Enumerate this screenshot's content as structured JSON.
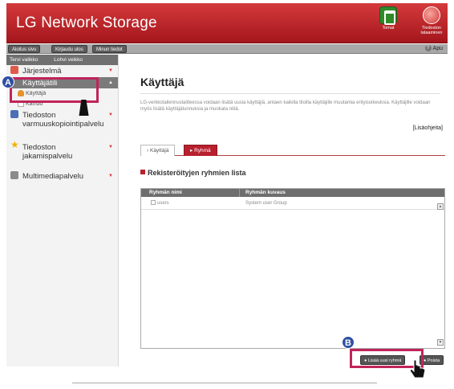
{
  "header": {
    "title": "LG Network Storage",
    "users_label": "Tomat",
    "help_label": "Tiedoston lataaminen"
  },
  "toolbar": {
    "btn1": "Aloitus sivu",
    "btn2": "Kirjaudu ulos",
    "btn3": "Minun tiedot",
    "help": "Apu"
  },
  "sidebar": {
    "top": [
      "Tervi valikko",
      "Lohvi veikko"
    ],
    "system": "Järjestelmä",
    "account": "Käyttäjätili",
    "user": "Käyttäjä",
    "group": "Kansio",
    "backup_line1": "Tiedoston",
    "backup_line2": "varmuuskopiointipalvelu",
    "share_line1": "Tiedoston",
    "share_line2": "jakamispalvelu",
    "media": "Multimediapalvelu"
  },
  "main": {
    "title": "Käyttäjä",
    "description": "LG-verkkotallennuslaitteessa voidaan lisätä uusia käyttäjiä, antaen kaikilla tiloilla käyttäjille muutamia erityisoikeuksia. Käyttäjille voidaan myös lisätä käyttäjätunnuksia ja muokata niitä.",
    "more_link": "[Lisäohjeita]",
    "tabs": [
      "Käyttäjä",
      "Ryhmä"
    ],
    "section_title": "Rekisteröityjen ryhmien lista",
    "table": {
      "headers": [
        "Ryhmän nimi",
        "Ryhmän kuvaus"
      ],
      "rows": [
        {
          "name": "users",
          "desc": "System user Group"
        }
      ]
    },
    "add_button": "Lisää uusi ryhmä",
    "delete_button": "Poista"
  },
  "annotations": {
    "a": "A",
    "b": "B"
  }
}
